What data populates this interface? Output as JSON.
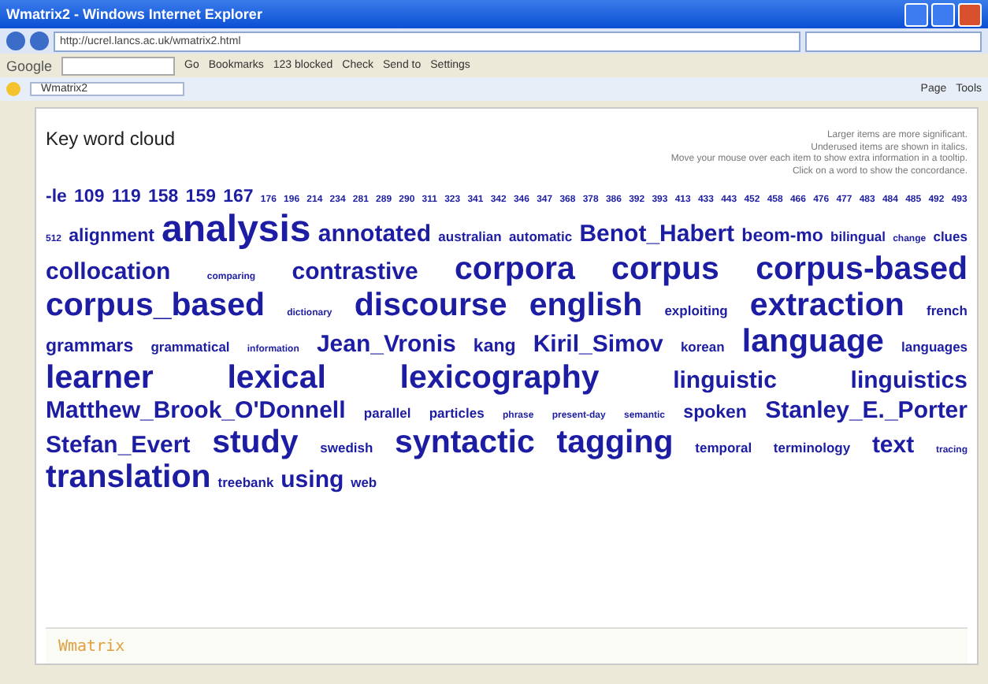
{
  "window": {
    "title": "Wmatrix2 - Windows Internet Explorer"
  },
  "address": {
    "value": "http://ucrel.lancs.ac.uk/wmatrix2.html"
  },
  "toolbar": {
    "brand": "Google",
    "buttons": [
      "Go",
      "Bookmarks",
      "123 blocked",
      "Check",
      "Send to",
      "Settings"
    ]
  },
  "tab": {
    "label": "Wmatrix2"
  },
  "command_bar": [
    "Page",
    "Tools"
  ],
  "page": {
    "heading": "Key word cloud",
    "notes": [
      "Larger items are more significant.",
      "Underused items are shown in italics.",
      "Move your mouse over each item to show extra information in a tooltip.",
      "Click on a word to show the concordance."
    ],
    "words": [
      {
        "text": "-le",
        "kind": "medium"
      },
      {
        "text": "109",
        "kind": "medium"
      },
      {
        "text": "119",
        "kind": "medium"
      },
      {
        "text": "158",
        "kind": "medium"
      },
      {
        "text": "159",
        "kind": "medium"
      },
      {
        "text": "167",
        "kind": "medium"
      },
      {
        "text": "176",
        "kind": "tiny"
      },
      {
        "text": "196",
        "kind": "tiny"
      },
      {
        "text": "214",
        "kind": "tiny"
      },
      {
        "text": "234",
        "kind": "tiny"
      },
      {
        "text": "281",
        "kind": "tiny"
      },
      {
        "text": "289",
        "kind": "tiny"
      },
      {
        "text": "290",
        "kind": "tiny"
      },
      {
        "text": "311",
        "kind": "tiny"
      },
      {
        "text": "323",
        "kind": "tiny"
      },
      {
        "text": "341",
        "kind": "tiny"
      },
      {
        "text": "342",
        "kind": "tiny"
      },
      {
        "text": "346",
        "kind": "tiny"
      },
      {
        "text": "347",
        "kind": "tiny"
      },
      {
        "text": "368",
        "kind": "tiny"
      },
      {
        "text": "378",
        "kind": "tiny"
      },
      {
        "text": "386",
        "kind": "tiny"
      },
      {
        "text": "392",
        "kind": "tiny"
      },
      {
        "text": "393",
        "kind": "tiny"
      },
      {
        "text": "413",
        "kind": "tiny"
      },
      {
        "text": "433",
        "kind": "tiny"
      },
      {
        "text": "443",
        "kind": "tiny"
      },
      {
        "text": "452",
        "kind": "tiny"
      },
      {
        "text": "458",
        "kind": "tiny"
      },
      {
        "text": "466",
        "kind": "tiny"
      },
      {
        "text": "476",
        "kind": "tiny"
      },
      {
        "text": "477",
        "kind": "tiny"
      },
      {
        "text": "483",
        "kind": "tiny"
      },
      {
        "text": "484",
        "kind": "tiny"
      },
      {
        "text": "485",
        "kind": "tiny"
      },
      {
        "text": "492",
        "kind": "tiny"
      },
      {
        "text": "493",
        "kind": "tiny"
      },
      {
        "text": "512",
        "kind": "tiny"
      },
      {
        "text": "alignment",
        "kind": "medium"
      },
      {
        "text": "analysis",
        "kind": "biggest"
      },
      {
        "text": "annotated",
        "kind": "large"
      },
      {
        "text": "australian",
        "kind": "small"
      },
      {
        "text": "automatic",
        "kind": "small"
      },
      {
        "text": "Benot_Habert",
        "kind": "large"
      },
      {
        "text": "beom-mo",
        "kind": "medium"
      },
      {
        "text": "bilingual",
        "kind": "small"
      },
      {
        "text": "change",
        "kind": "tiny"
      },
      {
        "text": "clues",
        "kind": "small"
      },
      {
        "text": "collocation",
        "kind": "large"
      },
      {
        "text": "comparing",
        "kind": "tiny"
      },
      {
        "text": "contrastive",
        "kind": "large"
      },
      {
        "text": "corpora",
        "kind": "huge"
      },
      {
        "text": "corpus",
        "kind": "huge"
      },
      {
        "text": "corpus-based",
        "kind": "huge"
      },
      {
        "text": "corpus_based",
        "kind": "huge"
      },
      {
        "text": "dictionary",
        "kind": "tiny"
      },
      {
        "text": "discourse",
        "kind": "huge"
      },
      {
        "text": "english",
        "kind": "huge"
      },
      {
        "text": "exploiting",
        "kind": "small"
      },
      {
        "text": "extraction",
        "kind": "huge"
      },
      {
        "text": "french",
        "kind": "small"
      },
      {
        "text": "grammars",
        "kind": "medium"
      },
      {
        "text": "grammatical",
        "kind": "small"
      },
      {
        "text": "information",
        "kind": "tiny"
      },
      {
        "text": "Jean_Vronis",
        "kind": "large"
      },
      {
        "text": "kang",
        "kind": "medium"
      },
      {
        "text": "Kiril_Simov",
        "kind": "large"
      },
      {
        "text": "korean",
        "kind": "small"
      },
      {
        "text": "language",
        "kind": "huge"
      },
      {
        "text": "languages",
        "kind": "small"
      },
      {
        "text": "learner",
        "kind": "huge"
      },
      {
        "text": "lexical",
        "kind": "huge"
      },
      {
        "text": "lexicography",
        "kind": "huge"
      },
      {
        "text": "linguistic",
        "kind": "large"
      },
      {
        "text": "linguistics",
        "kind": "large"
      },
      {
        "text": "Matthew_Brook_O'Donnell",
        "kind": "large"
      },
      {
        "text": "parallel",
        "kind": "small"
      },
      {
        "text": "particles",
        "kind": "small"
      },
      {
        "text": "phrase",
        "kind": "tiny"
      },
      {
        "text": "present-day",
        "kind": "tiny"
      },
      {
        "text": "semantic",
        "kind": "tiny"
      },
      {
        "text": "spoken",
        "kind": "medium"
      },
      {
        "text": "Stanley_E._Porter",
        "kind": "large"
      },
      {
        "text": "Stefan_Evert",
        "kind": "large"
      },
      {
        "text": "study",
        "kind": "huge"
      },
      {
        "text": "swedish",
        "kind": "small"
      },
      {
        "text": "syntactic",
        "kind": "huge"
      },
      {
        "text": "tagging",
        "kind": "huge"
      },
      {
        "text": "temporal",
        "kind": "small"
      },
      {
        "text": "terminology",
        "kind": "small"
      },
      {
        "text": "text",
        "kind": "large"
      },
      {
        "text": "tracing",
        "kind": "tiny"
      },
      {
        "text": "translation",
        "kind": "huge"
      },
      {
        "text": "treebank",
        "kind": "small"
      },
      {
        "text": "using",
        "kind": "large"
      },
      {
        "text": "web",
        "kind": "small"
      }
    ]
  },
  "footer": {
    "logo": "Wmatrix"
  }
}
